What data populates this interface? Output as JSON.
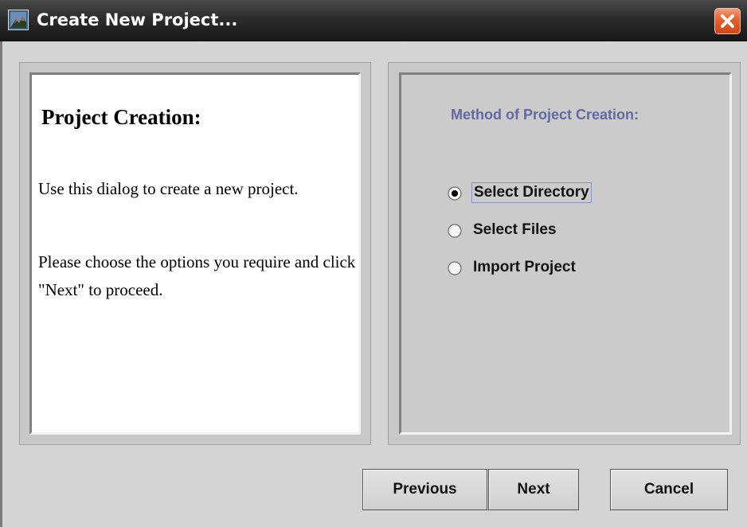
{
  "window": {
    "title": "Create New Project...",
    "close_icon": "close-icon",
    "app_icon": "app-icon"
  },
  "left_panel": {
    "heading": "Project Creation:",
    "paragraph1": "Use this dialog to create a new project.",
    "paragraph2": "Please choose the options you require and click \"Next\" to proceed."
  },
  "right_panel": {
    "heading": "Method of Project Creation:",
    "heading_color": "#6468a0",
    "options": [
      {
        "label": "Select Directory",
        "selected": true
      },
      {
        "label": "Select Files",
        "selected": false
      },
      {
        "label": "Import Project",
        "selected": false
      }
    ]
  },
  "buttons": {
    "previous": "Previous",
    "next": "Next",
    "cancel": "Cancel"
  }
}
